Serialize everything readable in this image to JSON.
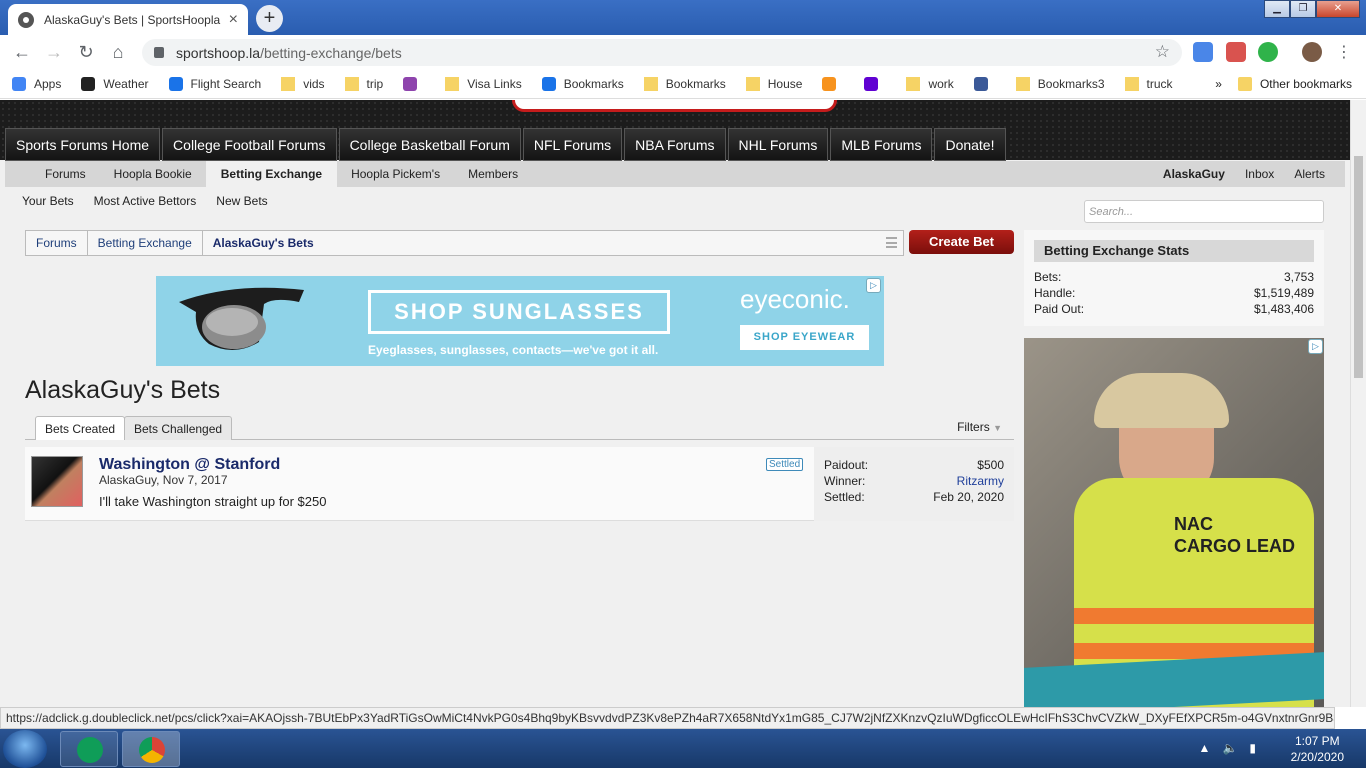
{
  "browser": {
    "tab_title": "AlaskaGuy's Bets | SportsHoopla",
    "tab_close": "×",
    "new_tab": "+",
    "window_min": "▁",
    "window_max": "❐",
    "window_close": "✕",
    "url_domain": "sportshoop.la",
    "url_path": "/betting-exchange/bets",
    "bookmarks": [
      {
        "label": "Apps",
        "icon": "apps-grid-icon",
        "color": "#4285f4"
      },
      {
        "label": "Weather",
        "icon": "weather-underground-icon",
        "color": "#222222"
      },
      {
        "label": "Flight Search",
        "icon": "flight-icon",
        "color": "#1a73e8"
      },
      {
        "label": "vids",
        "icon": "folder-icon",
        "color": "#f6d365"
      },
      {
        "label": "trip",
        "icon": "folder-icon",
        "color": "#f6d365"
      },
      {
        "label": "",
        "icon": "p-logo-icon",
        "color": "#8e44ad"
      },
      {
        "label": "Visa Links",
        "icon": "folder-icon",
        "color": "#f6d365"
      },
      {
        "label": "Bookmarks",
        "icon": "star-icon",
        "color": "#1a73e8"
      },
      {
        "label": "Bookmarks",
        "icon": "folder-icon",
        "color": "#f6d365"
      },
      {
        "label": "House",
        "icon": "folder-icon",
        "color": "#f6d365"
      },
      {
        "label": "",
        "icon": "ok-icon",
        "color": "#f7931e"
      },
      {
        "label": "",
        "icon": "yahoo-icon",
        "color": "#6001d2"
      },
      {
        "label": "work",
        "icon": "folder-icon",
        "color": "#f6d365"
      },
      {
        "label": "",
        "icon": "facebook-icon",
        "color": "#3b5998"
      },
      {
        "label": "Bookmarks3",
        "icon": "folder-icon",
        "color": "#f6d365"
      },
      {
        "label": "truck",
        "icon": "folder-icon",
        "color": "#f6d365"
      }
    ],
    "more_bookmarks": "»",
    "other_bookmarks": "Other bookmarks",
    "status_url": "https://adclick.g.doubleclick.net/pcs/click?xai=AKAOjssh-7BUtEbPx3YadRTiGsOwMiCt4NvkPG0s4Bhq9byKBsvvdvdPZ3Kv8ePZh4aR7X658NtdYx1mG85_CJ7W2jNfZXKnzvQzIuWDgficcOLEwHcIFhS3ChvCVZkW_DXyFEfXPCR5m-o4GVnxtnrGnr9B3Fpzyhct..."
  },
  "site": {
    "main_nav": [
      "Sports Forums Home",
      "College Football Forums",
      "College Basketball Forum",
      "NFL Forums",
      "NBA Forums",
      "NHL Forums",
      "MLB Forums",
      "Donate!"
    ],
    "sub_nav": [
      "Forums",
      "Hoopla Bookie",
      "Betting Exchange",
      "Hoopla Pickem's",
      "Members"
    ],
    "sub_nav_active": "Betting Exchange",
    "user_nav": [
      "AlaskaGuy",
      "Inbox",
      "Alerts"
    ],
    "section_links": [
      "Your Bets",
      "Most Active Bettors",
      "New Bets"
    ],
    "search_placeholder": "Search...",
    "breadcrumbs": [
      "Forums",
      "Betting Exchange",
      "AlaskaGuy's Bets"
    ],
    "create_bet": "Create Bet"
  },
  "ad_banner": {
    "headline": "SHOP SUNGLASSES",
    "subtext": "Eyeglasses, sunglasses, contacts—we've got it all.",
    "brand": "eyeconic.",
    "cta": "SHOP EYEWEAR",
    "adchoices": "▷",
    "bg_color": "#8fd3e8"
  },
  "main": {
    "page_title": "AlaskaGuy's Bets",
    "tabs": [
      "Bets Created",
      "Bets Challenged"
    ],
    "filters": "Filters",
    "bets": [
      {
        "title": "Washington @ Stanford",
        "author_date": "AlaskaGuy, Nov 7, 2017",
        "description": "I'll take Washington straight up for $250",
        "status": "Settled",
        "payout_label": "Paidout:",
        "payout": "$500",
        "winner_label": "Winner:",
        "winner": "Ritzarmy",
        "settled_label": "Settled:",
        "settled_date": "Feb 20, 2020"
      }
    ]
  },
  "sidebar": {
    "stats_title": "Betting Exchange Stats",
    "stats": [
      {
        "label": "Bets:",
        "value": "3,753"
      },
      {
        "label": "Handle:",
        "value": "$1,519,489"
      },
      {
        "label": "Paid Out:",
        "value": "$1,483,406"
      }
    ],
    "ad_vest_brand": "NAC",
    "ad_vest_text": "CARGO LEAD"
  },
  "taskbar": {
    "time": "1:07 PM",
    "date": "2/20/2020"
  }
}
